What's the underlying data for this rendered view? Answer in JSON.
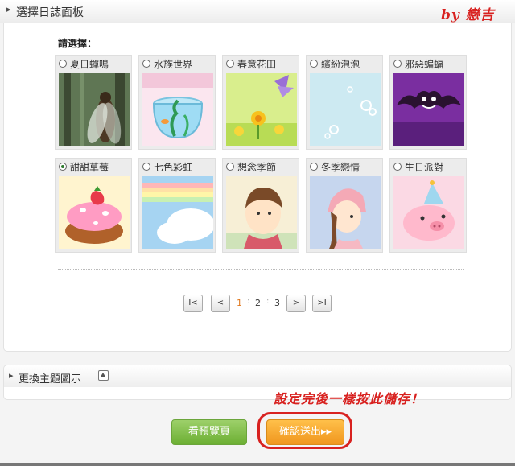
{
  "header": {
    "title": "選擇日誌面板",
    "signature": "by 戀吉"
  },
  "prompt": "請選擇：",
  "themes": [
    {
      "label": "夏日蟬鳴",
      "icon": "cicada-thumbnail",
      "selected": false
    },
    {
      "label": "水族世界",
      "icon": "fishbowl-thumbnail",
      "selected": false
    },
    {
      "label": "春意花田",
      "icon": "flower-field-thumbnail",
      "selected": false
    },
    {
      "label": "繽紛泡泡",
      "icon": "bubbles-thumbnail",
      "selected": false
    },
    {
      "label": "邪惡蝙蝠",
      "icon": "bat-thumbnail",
      "selected": false
    },
    {
      "label": "甜甜草莓",
      "icon": "strawberry-cake-thumbnail",
      "selected": true
    },
    {
      "label": "七色彩虹",
      "icon": "rainbow-thumbnail",
      "selected": false
    },
    {
      "label": "想念季節",
      "icon": "boy-thumbnail",
      "selected": false
    },
    {
      "label": "冬季戀情",
      "icon": "girl-thumbnail",
      "selected": false
    },
    {
      "label": "生日派對",
      "icon": "pig-party-thumbnail",
      "selected": false
    }
  ],
  "pagination": {
    "first": "I<",
    "prev": "<",
    "pages": [
      "1",
      "2",
      "3"
    ],
    "current": "1",
    "next": ">",
    "last": ">I"
  },
  "theme_section": {
    "title": "更換主題圖示"
  },
  "annotation": "設定完後一樣按此儲存！",
  "buttons": {
    "preview": "看預覽頁",
    "confirm": "確認送出",
    "confirm_arrow": "▸▸"
  },
  "colors": {
    "accent_red": "#d8211f",
    "confirm_orange": "#f0961e",
    "preview_green": "#6caf33",
    "current_page": "#e0781e"
  }
}
